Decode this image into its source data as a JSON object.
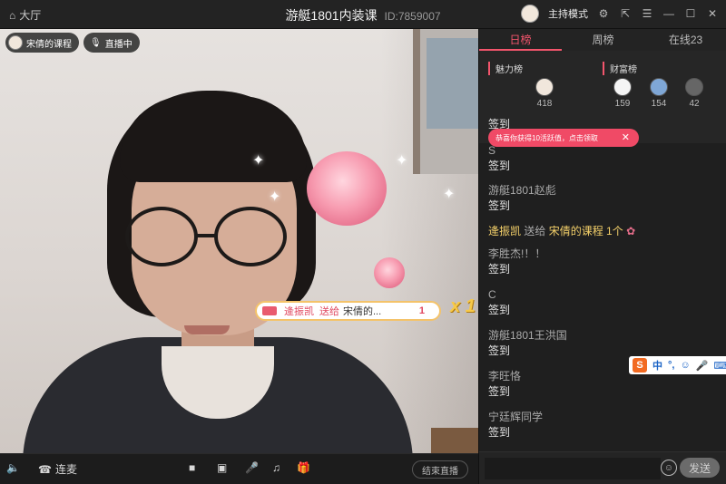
{
  "titlebar": {
    "home_label": "大厅",
    "title": "游艇1801内装课",
    "room_id": "ID:7859007",
    "host_mode": "主持模式"
  },
  "video": {
    "streamer_chip": "宋倩的课程",
    "live_chip": "直播中",
    "gift_banner": {
      "sender": "逄振凯",
      "verb": "送给",
      "receiver": "宋倩的...",
      "count": "1"
    },
    "combo": "x 1"
  },
  "controls": {
    "mic_link": "连麦",
    "end_live": "结束直播"
  },
  "panel": {
    "tabs": [
      "日榜",
      "周榜",
      "在线23"
    ],
    "charm_title": "魅力榜",
    "wealth_title": "财富榜",
    "charm_users": [
      {
        "value": "418"
      }
    ],
    "wealth_users": [
      {
        "value": "159"
      },
      {
        "value": "154"
      },
      {
        "value": "42"
      }
    ],
    "toast": "恭喜你获得10活跃值，点击领取",
    "chat": [
      {
        "name": "",
        "text": "签到"
      },
      {
        "name": "S",
        "text": "签到"
      },
      {
        "name": "游艇1801赵彪",
        "text": "签到"
      },
      {
        "name": "李胜杰!！！",
        "text": "签到"
      },
      {
        "name": "C",
        "text": "签到"
      },
      {
        "name": "游艇1801王洪国",
        "text": "签到"
      },
      {
        "name": "李旺恪",
        "text": "签到"
      },
      {
        "name": "宁廷辉同学",
        "text": "签到"
      }
    ],
    "gift_msg": {
      "sender": "逄振凯",
      "verb": "送给",
      "target": "宋倩的课程 1个"
    },
    "ime": "中",
    "input_placeholder": "",
    "send": "发送"
  },
  "colors": {
    "accent": "#f3556c",
    "gift_gold": "#f5d16a",
    "panel_bg": "#1f1f1f"
  }
}
